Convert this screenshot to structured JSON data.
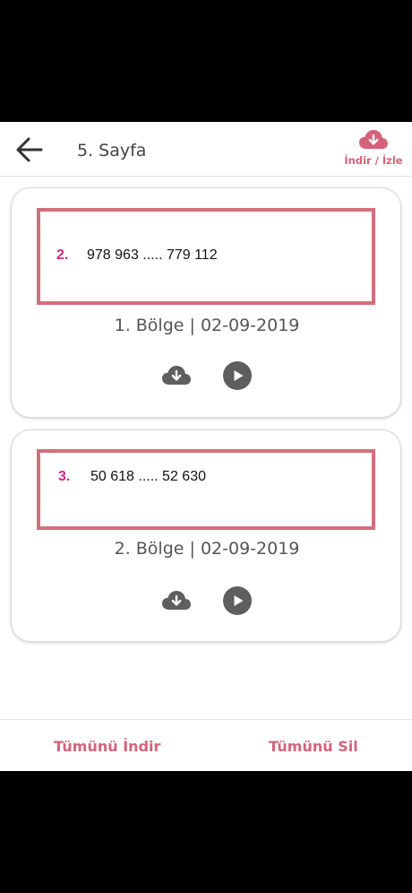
{
  "header": {
    "title": "5. Sayfa",
    "download_label": "İndir / İzle"
  },
  "cards": [
    {
      "number": "2.",
      "value": "978 963 ..... 779 112",
      "region": "1. Bölge | 02-09-2019"
    },
    {
      "number": "3.",
      "value": "50 618 ..... 52 630",
      "region": "2. Bölge | 02-09-2019"
    }
  ],
  "footer": {
    "download_all": "Tümünü İndir",
    "delete_all": "Tümünü Sil"
  },
  "colors": {
    "accent": "#d4637a",
    "frame": "#d36f7a",
    "number": "#cc2a8a",
    "icon": "#5e5e5e"
  },
  "icons": {
    "back": "arrow-left-icon",
    "cloud_download": "cloud-download-icon",
    "play": "play-circle-icon"
  }
}
